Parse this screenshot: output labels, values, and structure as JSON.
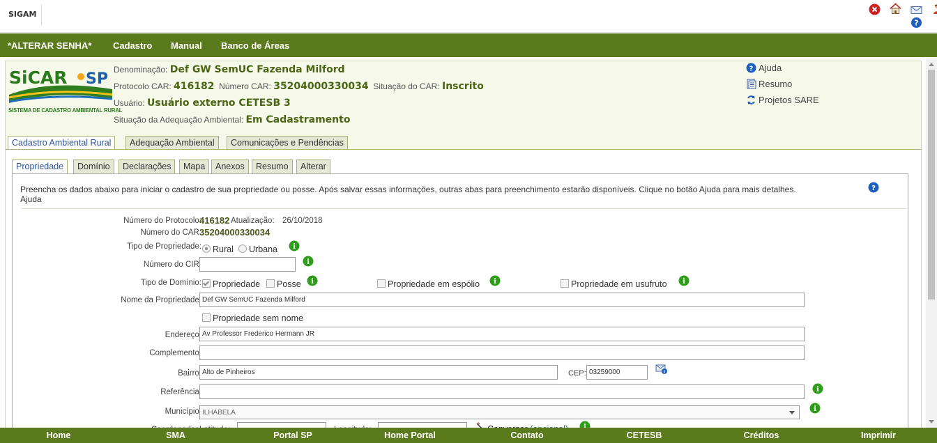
{
  "app": {
    "brand": "SIGAM"
  },
  "nav": {
    "items": [
      "*ALTERAR SENHA*",
      "Cadastro",
      "Manual",
      "Banco de Áreas"
    ]
  },
  "logo": {
    "text": "SICAR-SP",
    "subtitle": "SISTEMA DE CADASTRO AMBIENTAL RURAL"
  },
  "header": {
    "denominacao_label": "Denominação:",
    "denominacao_value": "Def GW SemUC Fazenda Milford",
    "protocolo_label": "Protocolo CAR:",
    "protocolo_value": "416182",
    "numero_car_label": "Número CAR:",
    "numero_car_value": "35204000330034",
    "situacao_car_label": "Situação do CAR:",
    "situacao_car_value": "Inscrito",
    "usuario_label": "Usuário:",
    "usuario_value": "Usuário externo CETESB 3",
    "adequacao_label": "Situação da Adequação Ambiental:",
    "adequacao_value": "Em Cadastramento"
  },
  "right_links": {
    "ajuda": "Ajuda",
    "resumo": "Resumo",
    "projetos": "Projetos SARE"
  },
  "tabs_main": [
    "Cadastro Ambiental Rural",
    "Adequação Ambiental",
    "Comunicações e Pendências"
  ],
  "tabs_sub": [
    "Propriedade",
    "Domínio",
    "Declarações",
    "Mapa",
    "Anexos",
    "Resumo",
    "Alterar"
  ],
  "intro": {
    "line1": "Preencha os dados abaixo para iniciar o cadastro de sua propriedade ou posse. Após salvar essas informações, outras abas para preenchimento estarão disponíveis. Clique no botão Ajuda para mais detalhes.",
    "line2": "Ajuda"
  },
  "form": {
    "num_protocolo_label": "Número do Protocolo:",
    "num_protocolo_value": "416182",
    "atualizacao_label": "Atualização:",
    "atualizacao_value": "26/10/2018",
    "num_car_label": "Número do CAR:",
    "num_car_value": "35204000330034",
    "tipo_propriedade_label": "Tipo de Propriedade:",
    "tipo_rural": "Rural",
    "tipo_urbana": "Urbana",
    "cir_label": "Número do CIR:",
    "cir_value": "",
    "tipo_dominio_label": "Tipo de Domínio:",
    "dom_propriedade": "Propriedade",
    "dom_posse": "Posse",
    "dom_espolio": "Propriedade em espólio",
    "dom_usufruto": "Propriedade em usufruto",
    "nome_prop_label": "Nome da Propriedade:",
    "nome_prop_value": "Def GW SemUC Fazenda Milford",
    "sem_nome": "Propriedade sem nome",
    "endereco_label": "Endereço:",
    "endereco_value": "Av Professor Frederico Hermann JR",
    "complemento_label": "Complemento:",
    "complemento_value": "",
    "bairro_label": "Bairro:",
    "bairro_value": "Alto de Pinheiros",
    "cep_label": "CEP:",
    "cep_value": "03259000",
    "referencia_label": "Referência:",
    "referencia_value": "",
    "municipio_label": "Município:",
    "municipio_value": "ILHABELA",
    "coordenadas_label": "Coordenadas:",
    "latitude_label": "Latitude:",
    "longitude_label": "Longitude:",
    "conversor": "Conversor",
    "opcional": "(opcional)"
  },
  "footer": {
    "items": [
      "Home",
      "SMA",
      "Portal SP",
      "Home Portal",
      "Contato",
      "CETESB",
      "Créditos",
      "Imprimir"
    ]
  },
  "colors": {
    "nav_green": "#5b7a1c",
    "panel_bg": "#f6f9ea",
    "value_green": "#4a6614"
  }
}
